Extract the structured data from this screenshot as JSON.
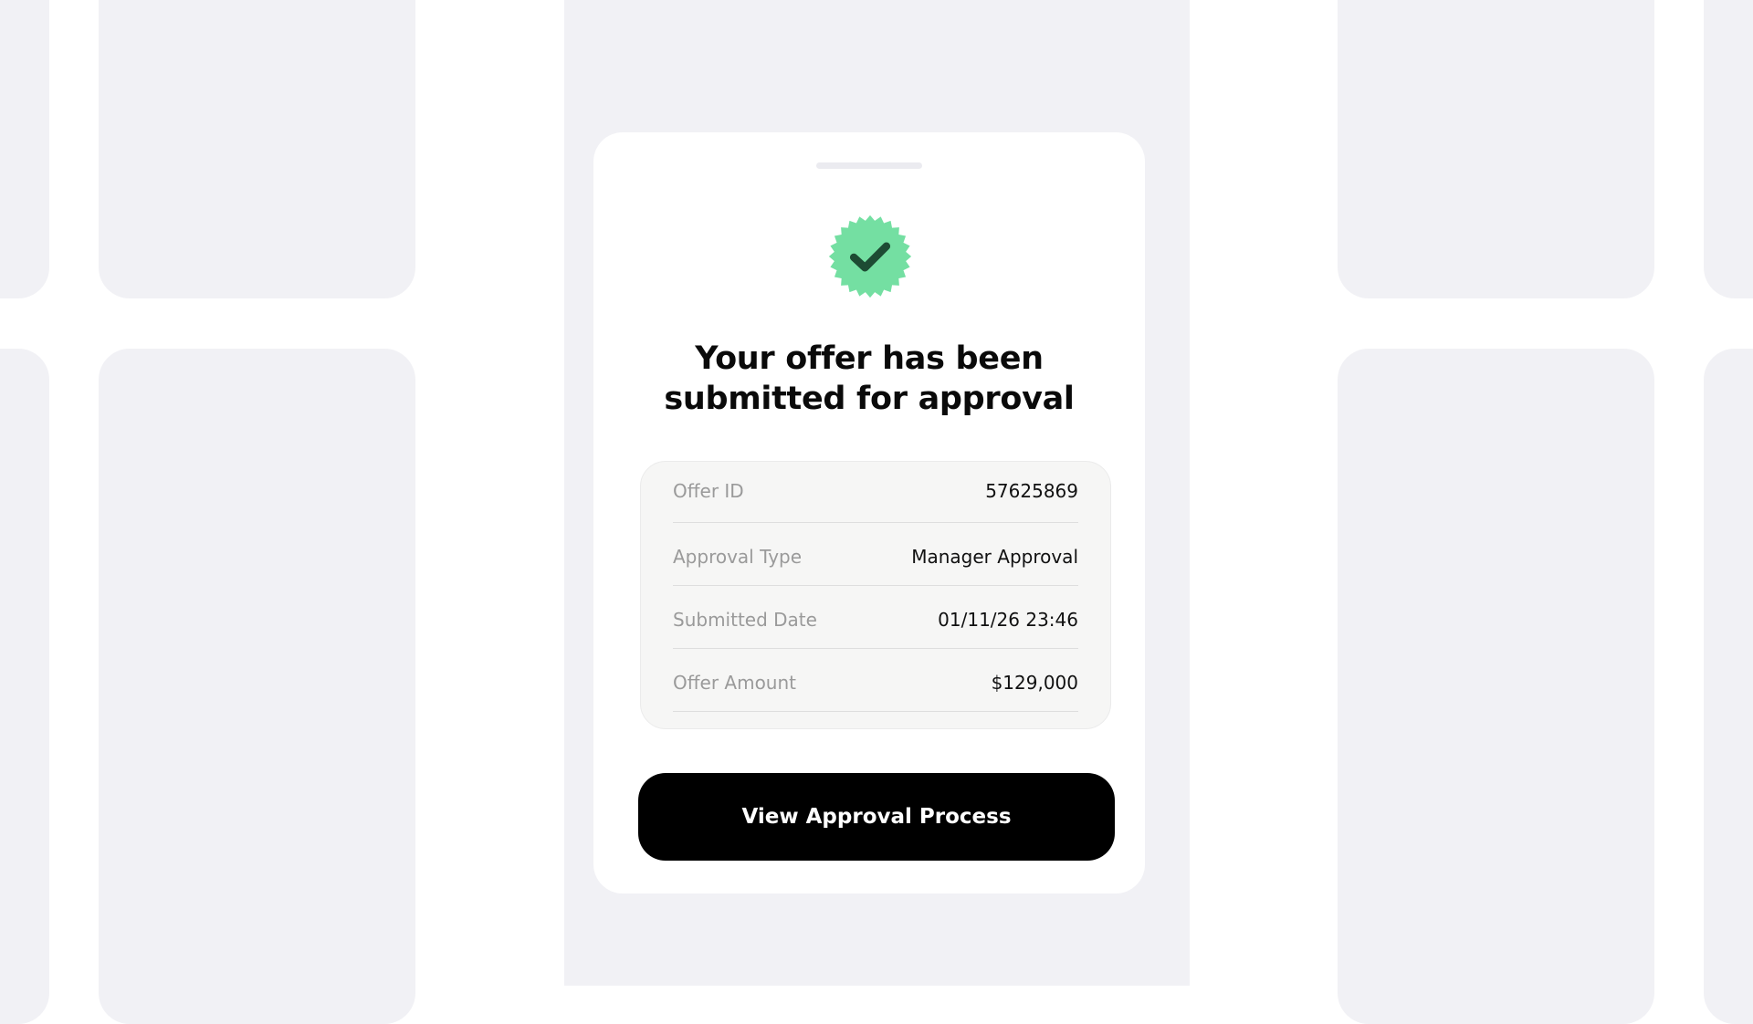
{
  "modal": {
    "icon": "verified-check-badge-icon",
    "title": "Your offer has been submitted for approval",
    "details": [
      {
        "label": "Offer ID",
        "value": "57625869"
      },
      {
        "label": "Approval Type",
        "value": "Manager Approval"
      },
      {
        "label": "Submitted Date",
        "value": "01/11/26 23:46"
      },
      {
        "label": "Offer Amount",
        "value": "$129,000"
      }
    ],
    "button_label": "View Approval Process"
  },
  "colors": {
    "badge_fill": "#74dfa2",
    "check_mark": "#1d4b33",
    "button_bg": "#000000",
    "background_tiles": "#f1f1f5"
  }
}
